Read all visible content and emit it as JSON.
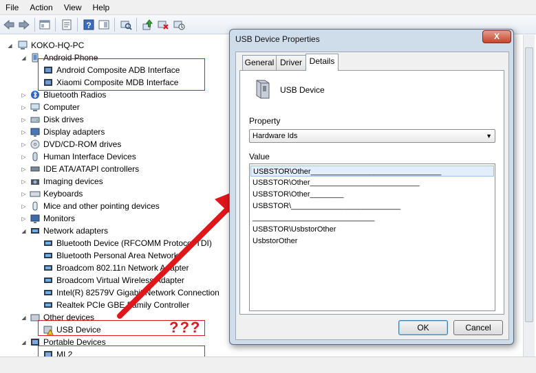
{
  "menu": [
    "File",
    "Action",
    "View",
    "Help"
  ],
  "tree": {
    "root": "KOKO-HQ-PC",
    "items": [
      {
        "label": "Android Phone"
      },
      {
        "label": "Android Composite ADB Interface"
      },
      {
        "label": "Xiaomi Composite MDB Interface"
      },
      {
        "label": "Bluetooth Radios"
      },
      {
        "label": "Computer"
      },
      {
        "label": "Disk drives"
      },
      {
        "label": "Display adapters"
      },
      {
        "label": "DVD/CD-ROM drives"
      },
      {
        "label": "Human Interface Devices"
      },
      {
        "label": "IDE ATA/ATAPI controllers"
      },
      {
        "label": "Imaging devices"
      },
      {
        "label": "Keyboards"
      },
      {
        "label": "Mice and other pointing devices"
      },
      {
        "label": "Monitors"
      },
      {
        "label": "Network adapters"
      },
      {
        "label": "Bluetooth Device (RFCOMM Protocol TDI)"
      },
      {
        "label": "Bluetooth Personal Area Network"
      },
      {
        "label": "Broadcom 802.11n Network Adapter"
      },
      {
        "label": "Broadcom Virtual Wireless Adapter"
      },
      {
        "label": "Intel(R) 82579V Gigabit Network Connection"
      },
      {
        "label": "Realtek PCIe GBE Family Controller"
      },
      {
        "label": "Other devices"
      },
      {
        "label": "USB Device"
      },
      {
        "label": "Portable Devices"
      },
      {
        "label": "MI 2"
      }
    ]
  },
  "annotation": "???",
  "dialog": {
    "title": "USB Device Properties",
    "close": "X",
    "tabs": [
      "General",
      "Driver",
      "Details"
    ],
    "device_name": "USB Device",
    "property_label": "Property",
    "property_value": "Hardware Ids",
    "value_label": "Value",
    "values": [
      "USBSTOR\\Other_______________________________",
      "USBSTOR\\Other__________________________",
      "USBSTOR\\Other________",
      "USBSTOR\\__________________________",
      "_____________________________",
      "USBSTOR\\UsbstorOther",
      "UsbstorOther"
    ],
    "ok": "OK",
    "cancel": "Cancel"
  },
  "colors": {
    "annotation": "#e0161b",
    "selected_row": "#e3eefb"
  }
}
